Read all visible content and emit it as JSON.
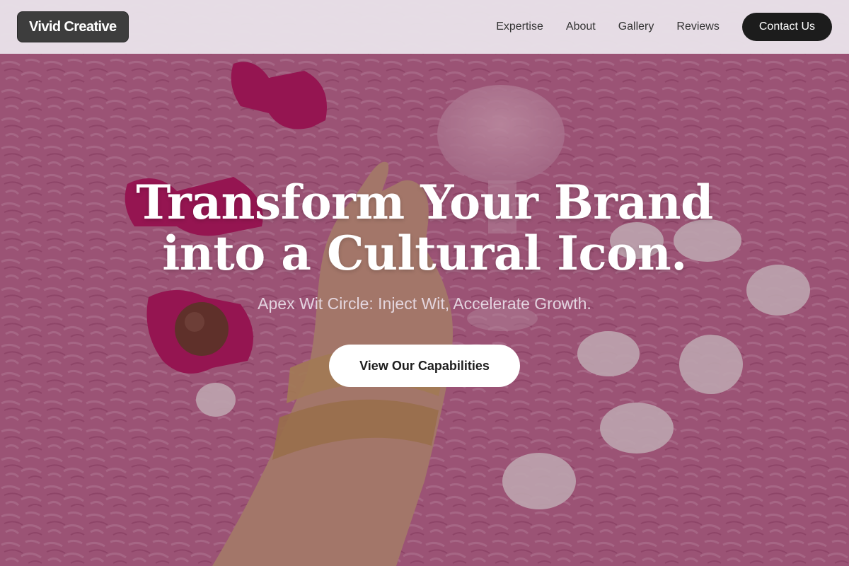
{
  "brand": {
    "logo_text": "Vivid Creative"
  },
  "nav": {
    "links": [
      "Expertise",
      "About",
      "Gallery",
      "Reviews"
    ],
    "contact_label": "Contact Us"
  },
  "hero": {
    "headline_line1": "Transform Your Brand",
    "headline_line2": "into a Cultural Icon.",
    "subheadline": "Apex Wit Circle: Inject Wit, Accelerate Growth.",
    "cta_label": "View Our Capabilities"
  },
  "colors": {
    "nav_background": "#e8e1e8",
    "logo_background": "#3d3d3d",
    "contact_button": "#1c1c1c",
    "hero_background": "#b0597f",
    "cta_background": "#ffffff"
  }
}
